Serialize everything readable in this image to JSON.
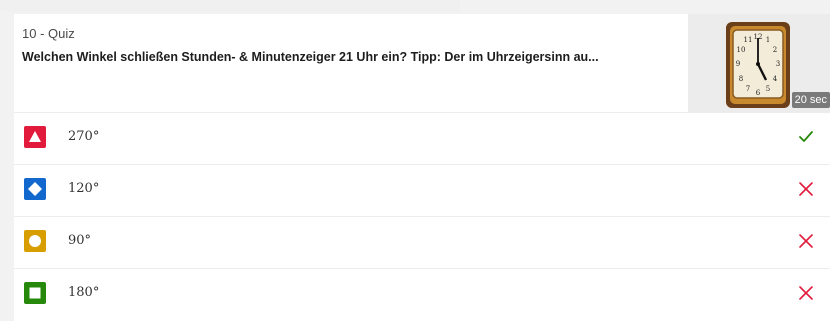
{
  "question": {
    "number_type": "10 - Quiz",
    "text": "Welchen Winkel schließen Stunden- & Minutenzeiger 21 Uhr ein? Tipp: Der im Uhrzeigersinn au...",
    "time_limit": "20 sec",
    "image_icon": "wall-clock-image"
  },
  "options": [
    {
      "label": "270°",
      "shape": "triangle",
      "color": "#e21b3c",
      "correct": true
    },
    {
      "label": "120°",
      "shape": "diamond",
      "color": "#1368ce",
      "correct": false
    },
    {
      "label": "90°",
      "shape": "circle",
      "color": "#d89e00",
      "correct": false
    },
    {
      "label": "180°",
      "shape": "square",
      "color": "#26890c",
      "correct": false
    }
  ],
  "colors": {
    "correct": "#26890c",
    "incorrect": "#e21b3c"
  }
}
